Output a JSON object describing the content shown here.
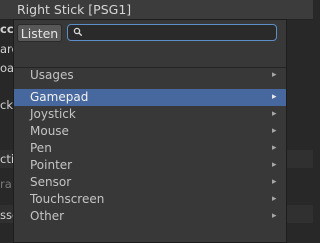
{
  "window": {
    "title": "Right Stick [PSG1]"
  },
  "background": {
    "fragments": [
      "cc",
      "arc",
      "oac",
      "ck",
      "cti",
      "ra",
      "ssc"
    ]
  },
  "popup": {
    "listen_label": "Listen",
    "search": {
      "value": "",
      "placeholder": ""
    },
    "items": [
      {
        "label": "Usages",
        "selected": false
      },
      {
        "label": "Gamepad",
        "selected": true
      },
      {
        "label": "Joystick",
        "selected": false
      },
      {
        "label": "Mouse",
        "selected": false
      },
      {
        "label": "Pen",
        "selected": false
      },
      {
        "label": "Pointer",
        "selected": false
      },
      {
        "label": "Sensor",
        "selected": false
      },
      {
        "label": "Touchscreen",
        "selected": false
      },
      {
        "label": "Other",
        "selected": false
      }
    ],
    "chevron_icon": "chevron-right-icon",
    "chevron_glyph": "▸",
    "selection_color": "#46689e",
    "focus_color": "#5c8ec8"
  }
}
